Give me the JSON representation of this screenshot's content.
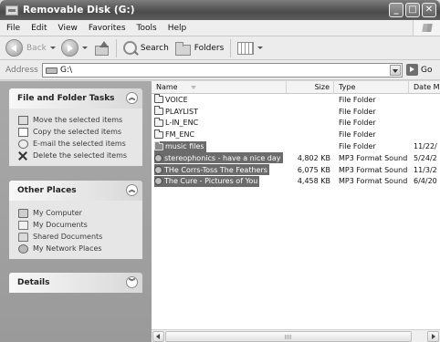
{
  "window": {
    "title": "Removable Disk (G:)",
    "buttons": {
      "minimize": "_",
      "maximize": "□",
      "close": "✕"
    }
  },
  "menu": [
    "File",
    "Edit",
    "View",
    "Favorites",
    "Tools",
    "Help"
  ],
  "toolbar": {
    "back_label": "Back",
    "search_label": "Search",
    "folders_label": "Folders"
  },
  "address": {
    "label": "Address",
    "value": "G:\\",
    "go_label": "Go"
  },
  "tasks_panel": {
    "title": "File and Folder Tasks",
    "items": [
      "Move the selected items",
      "Copy the selected items",
      "E-mail the selected items",
      "Delete the selected items"
    ]
  },
  "places_panel": {
    "title": "Other Places",
    "items": [
      "My Computer",
      "My Documents",
      "Shared Documents",
      "My Network Places"
    ]
  },
  "details_panel": {
    "title": "Details"
  },
  "columns": {
    "name": "Name",
    "size": "Size",
    "type": "Type",
    "date": "Date M"
  },
  "files": [
    {
      "name": "VOICE",
      "size": "",
      "type": "File Folder",
      "date": "",
      "kind": "folder",
      "selected": false
    },
    {
      "name": "PLAYLIST",
      "size": "",
      "type": "File Folder",
      "date": "",
      "kind": "folder",
      "selected": false
    },
    {
      "name": "L-IN_ENC",
      "size": "",
      "type": "File Folder",
      "date": "",
      "kind": "folder",
      "selected": false
    },
    {
      "name": "FM_ENC",
      "size": "",
      "type": "File Folder",
      "date": "",
      "kind": "folder",
      "selected": false
    },
    {
      "name": "music files",
      "size": "",
      "type": "File Folder",
      "date": "11/22/",
      "kind": "folder",
      "selected": true
    },
    {
      "name": "stereophonics - have a nice day",
      "size": "4,802 KB",
      "type": "MP3 Format Sound",
      "date": "5/24/2",
      "kind": "mp3",
      "selected": true
    },
    {
      "name": "THe Corrs-Toss The Feathers",
      "size": "6,075 KB",
      "type": "MP3 Format Sound",
      "date": "11/3/2",
      "kind": "mp3",
      "selected": true
    },
    {
      "name": "The Cure - Pictures of You",
      "size": "4,458 KB",
      "type": "MP3 Format Sound",
      "date": "6/4/20",
      "kind": "mp3",
      "selected": true
    }
  ]
}
